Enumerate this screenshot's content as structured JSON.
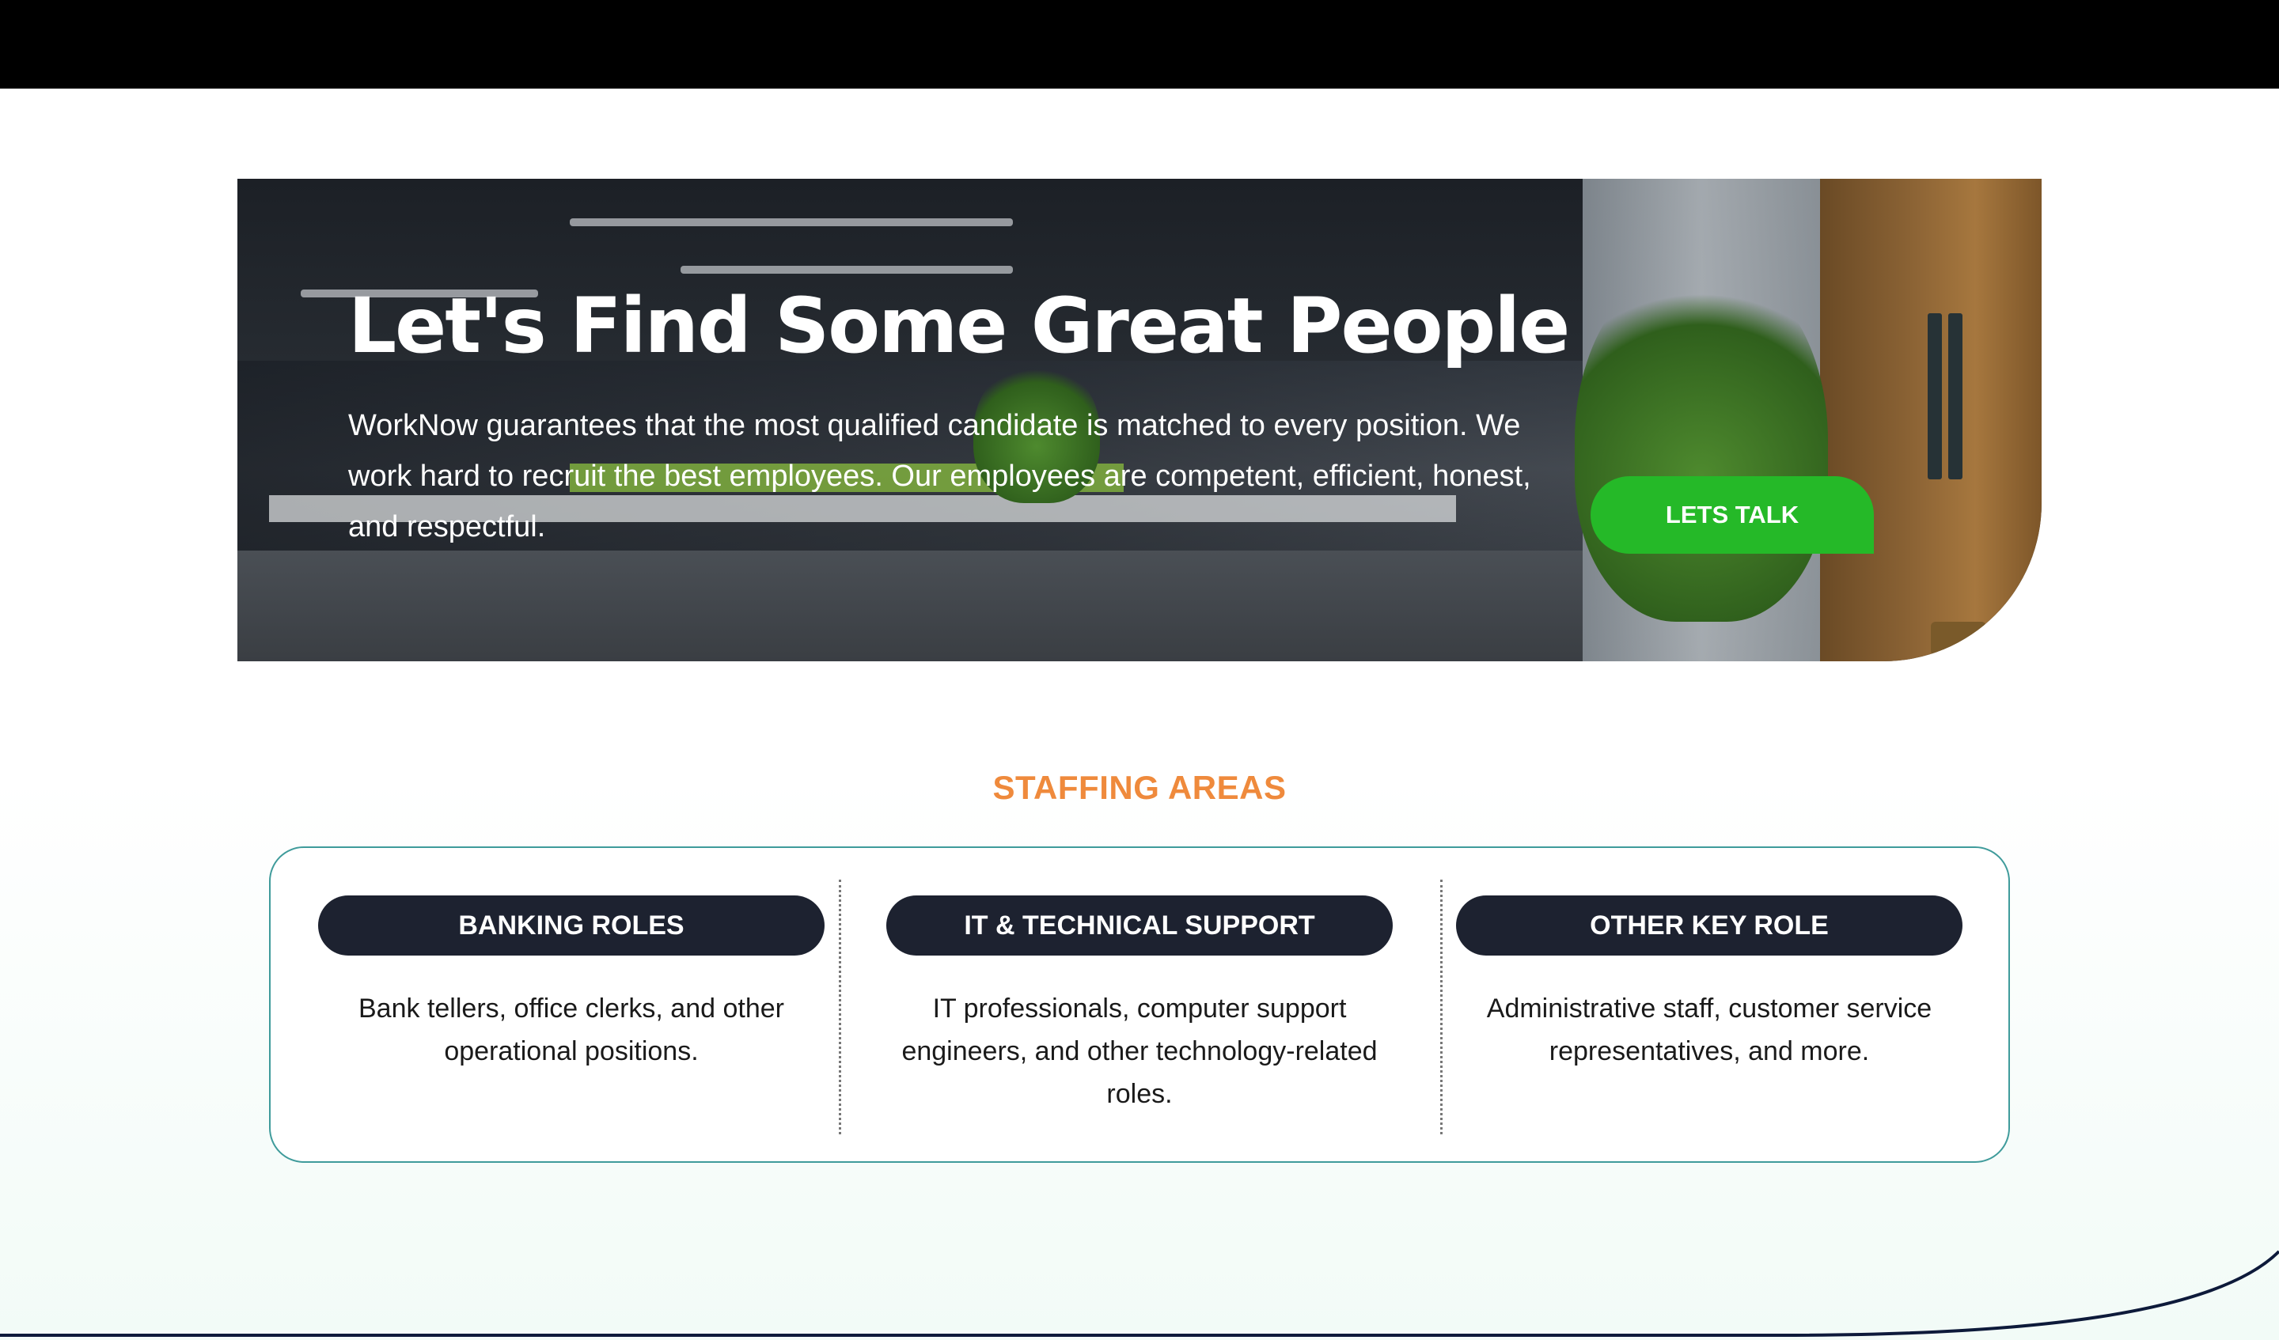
{
  "hero": {
    "title": "Let's Find Some Great People",
    "description": "WorkNow guarantees that the most qualified candidate is matched to every position. We work hard to recruit the best employees. Our employees are competent, efficient, honest, and respectful.",
    "cta_label": "LETS TALK"
  },
  "staffing": {
    "title": "STAFFING AREAS",
    "areas": [
      {
        "label": "BANKING ROLES",
        "description": "Bank tellers, office clerks, and other operational positions."
      },
      {
        "label": "IT & TECHNICAL SUPPORT",
        "description": "IT professionals, computer support engineers, and other technology-related roles."
      },
      {
        "label": "OTHER KEY ROLE",
        "description": "Administrative staff, customer service representatives, and more."
      }
    ]
  },
  "colors": {
    "cta": "#25b928",
    "section_title": "#ef8a3c",
    "pill": "#1d2230",
    "card_border": "#3f9b9b",
    "wave": "#0d1a3a"
  }
}
